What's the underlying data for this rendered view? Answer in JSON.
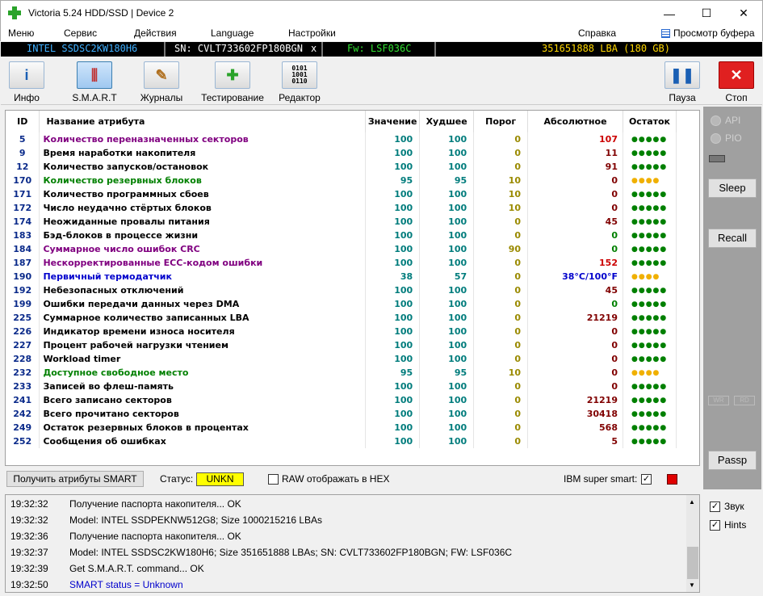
{
  "window": {
    "title": "Victoria 5.24 HDD/SSD | Device 2",
    "minimize": "—",
    "maximize": "☐",
    "close": "✕"
  },
  "menu": {
    "items": [
      "Меню",
      "Сервис",
      "Действия",
      "Language",
      "Настройки",
      "Справка"
    ],
    "buffer_view": "Просмотр буфера"
  },
  "device": {
    "model": "INTEL SSDSC2KW180H6",
    "sn": "SN: CVLT733602FP180BGN",
    "close": "x",
    "fw": "Fw: LSF036C",
    "size": "351651888 LBA (180 GB)"
  },
  "toolbar": {
    "info": "Инфо",
    "smart": "S.M.A.R.T",
    "journals": "Журналы",
    "testing": "Тестирование",
    "editor": "Редактор",
    "pause": "Пауза",
    "stop": "Стоп"
  },
  "table": {
    "headers": [
      "ID",
      "Название атрибута",
      "Значение",
      "Худшее",
      "Порог",
      "Абсолютное",
      "Остаток"
    ],
    "rows": [
      {
        "id": "5",
        "name": "Количество переназначенных секторов",
        "value": "100",
        "worst": "100",
        "thr": "0",
        "raw": "107",
        "rest": "●●●●●",
        "name_color": "#800080",
        "raw_color": "#cc0000",
        "dot_color": "#008000"
      },
      {
        "id": "9",
        "name": "Время наработки накопителя",
        "value": "100",
        "worst": "100",
        "thr": "0",
        "raw": "11",
        "rest": "●●●●●",
        "name_color": "#000000",
        "raw_color": "#800000",
        "dot_color": "#008000"
      },
      {
        "id": "12",
        "name": "Количество запусков/остановок",
        "value": "100",
        "worst": "100",
        "thr": "0",
        "raw": "91",
        "rest": "●●●●●",
        "name_color": "#000000",
        "raw_color": "#800000",
        "dot_color": "#008000"
      },
      {
        "id": "170",
        "name": "Количество резервных блоков",
        "value": "95",
        "worst": "95",
        "thr": "10",
        "raw": "0",
        "rest": "●●●●",
        "name_color": "#008000",
        "raw_color": "#800000",
        "dot_color": "#f0b000"
      },
      {
        "id": "171",
        "name": "Количество программных сбоев",
        "value": "100",
        "worst": "100",
        "thr": "10",
        "raw": "0",
        "rest": "●●●●●",
        "name_color": "#000000",
        "raw_color": "#800000",
        "dot_color": "#008000"
      },
      {
        "id": "172",
        "name": "Число неудачно стёртых блоков",
        "value": "100",
        "worst": "100",
        "thr": "10",
        "raw": "0",
        "rest": "●●●●●",
        "name_color": "#000000",
        "raw_color": "#800000",
        "dot_color": "#008000"
      },
      {
        "id": "174",
        "name": "Неожиданные провалы питания",
        "value": "100",
        "worst": "100",
        "thr": "0",
        "raw": "45",
        "rest": "●●●●●",
        "name_color": "#000000",
        "raw_color": "#800000",
        "dot_color": "#008000"
      },
      {
        "id": "183",
        "name": "Бэд-блоков в процессе жизни",
        "value": "100",
        "worst": "100",
        "thr": "0",
        "raw": "0",
        "rest": "●●●●●",
        "name_color": "#000000",
        "raw_color": "#008000",
        "dot_color": "#008000"
      },
      {
        "id": "184",
        "name": "Суммарное число ошибок CRC",
        "value": "100",
        "worst": "100",
        "thr": "90",
        "raw": "0",
        "rest": "●●●●●",
        "name_color": "#800080",
        "raw_color": "#008000",
        "dot_color": "#008000"
      },
      {
        "id": "187",
        "name": "Нескорректированные ECC-кодом ошибки",
        "value": "100",
        "worst": "100",
        "thr": "0",
        "raw": "152",
        "rest": "●●●●●",
        "name_color": "#800080",
        "raw_color": "#cc0000",
        "dot_color": "#008000"
      },
      {
        "id": "190",
        "name": "Первичный термодатчик",
        "value": "38",
        "worst": "57",
        "thr": "0",
        "raw": "38°C/100°F",
        "rest": "●●●●",
        "name_color": "#0000cc",
        "raw_color": "#0000cc",
        "dot_color": "#f0b000"
      },
      {
        "id": "192",
        "name": "Небезопасных отключений",
        "value": "100",
        "worst": "100",
        "thr": "0",
        "raw": "45",
        "rest": "●●●●●",
        "name_color": "#000000",
        "raw_color": "#800000",
        "dot_color": "#008000"
      },
      {
        "id": "199",
        "name": "Ошибки передачи данных через DMA",
        "value": "100",
        "worst": "100",
        "thr": "0",
        "raw": "0",
        "rest": "●●●●●",
        "name_color": "#000000",
        "raw_color": "#008000",
        "dot_color": "#008000"
      },
      {
        "id": "225",
        "name": "Суммарное количество записанных LBA",
        "value": "100",
        "worst": "100",
        "thr": "0",
        "raw": "21219",
        "rest": "●●●●●",
        "name_color": "#000000",
        "raw_color": "#800000",
        "dot_color": "#008000"
      },
      {
        "id": "226",
        "name": "Индикатор времени износа носителя",
        "value": "100",
        "worst": "100",
        "thr": "0",
        "raw": "0",
        "rest": "●●●●●",
        "name_color": "#000000",
        "raw_color": "#800000",
        "dot_color": "#008000"
      },
      {
        "id": "227",
        "name": "Процент рабочей нагрузки чтением",
        "value": "100",
        "worst": "100",
        "thr": "0",
        "raw": "0",
        "rest": "●●●●●",
        "name_color": "#000000",
        "raw_color": "#800000",
        "dot_color": "#008000"
      },
      {
        "id": "228",
        "name": "Workload timer",
        "value": "100",
        "worst": "100",
        "thr": "0",
        "raw": "0",
        "rest": "●●●●●",
        "name_color": "#000000",
        "raw_color": "#800000",
        "dot_color": "#008000"
      },
      {
        "id": "232",
        "name": "Доступное свободное место",
        "value": "95",
        "worst": "95",
        "thr": "10",
        "raw": "0",
        "rest": "●●●●",
        "name_color": "#008000",
        "raw_color": "#800000",
        "dot_color": "#f0b000"
      },
      {
        "id": "233",
        "name": "Записей во флеш-память",
        "value": "100",
        "worst": "100",
        "thr": "0",
        "raw": "0",
        "rest": "●●●●●",
        "name_color": "#000000",
        "raw_color": "#800000",
        "dot_color": "#008000"
      },
      {
        "id": "241",
        "name": "Всего записано секторов",
        "value": "100",
        "worst": "100",
        "thr": "0",
        "raw": "21219",
        "rest": "●●●●●",
        "name_color": "#000000",
        "raw_color": "#800000",
        "dot_color": "#008000"
      },
      {
        "id": "242",
        "name": "Всего прочитано секторов",
        "value": "100",
        "worst": "100",
        "thr": "0",
        "raw": "30418",
        "rest": "●●●●●",
        "name_color": "#000000",
        "raw_color": "#800000",
        "dot_color": "#008000"
      },
      {
        "id": "249",
        "name": "Остаток резервных блоков в процентах",
        "value": "100",
        "worst": "100",
        "thr": "0",
        "raw": "568",
        "rest": "●●●●●",
        "name_color": "#000000",
        "raw_color": "#800000",
        "dot_color": "#008000"
      },
      {
        "id": "252",
        "name": "Сообщения об ошибках",
        "value": "100",
        "worst": "100",
        "thr": "0",
        "raw": "5",
        "rest": "●●●●●",
        "name_color": "#000000",
        "raw_color": "#800000",
        "dot_color": "#008000"
      }
    ]
  },
  "bottom": {
    "get_smart": "Получить атрибуты SMART",
    "status_label": "Статус:",
    "status_value": "UNKN",
    "raw_hex": "RAW отображать в HEX",
    "ibm_label": "IBM super smart:",
    "ibm_checked": "✓"
  },
  "side": {
    "api": "API",
    "pio": "PIO",
    "sleep": "Sleep",
    "recall": "Recall",
    "passp": "Passp",
    "wr": "WR",
    "rd": "RD"
  },
  "log": [
    {
      "time": "19:32:32",
      "msg": "Получение паспорта накопителя... OK",
      "color": "#000000"
    },
    {
      "time": "19:32:32",
      "msg": "Model: INTEL SSDPEKNW512G8; Size 1000215216 LBAs",
      "color": "#000000"
    },
    {
      "time": "19:32:36",
      "msg": "Получение паспорта накопителя... OK",
      "color": "#000000"
    },
    {
      "time": "19:32:37",
      "msg": "Model: INTEL SSDSC2KW180H6; Size 351651888 LBAs; SN: CVLT733602FP180BGN; FW: LSF036C",
      "color": "#000000"
    },
    {
      "time": "19:32:39",
      "msg": "Get S.M.A.R.T. command... OK",
      "color": "#000000"
    },
    {
      "time": "19:32:50",
      "msg": "SMART status = Unknown",
      "color": "#0000cc"
    }
  ],
  "side2": {
    "sound": "Звук",
    "hints": "Hints",
    "check": "✓"
  }
}
